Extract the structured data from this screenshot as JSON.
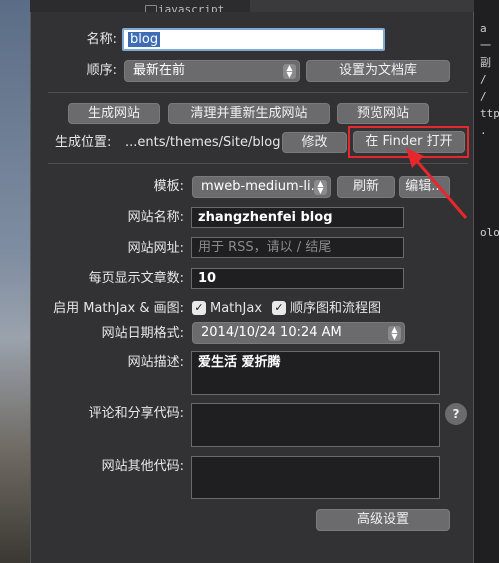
{
  "background": {
    "top_label": "iavascript",
    "right_chars": [
      "a",
      "一副",
      "/",
      "/",
      "ttp",
      ".",
      "",
      "",
      "",
      "",
      "",
      "olo"
    ]
  },
  "form": {
    "name_label": "名称:",
    "name_value": "blog",
    "order_label": "顺序:",
    "order_value": "最新在前",
    "set_doc_lib_button": "设置为文档库"
  },
  "actions": {
    "generate_button": "生成网站",
    "clean_regenerate_button": "清理并重新生成网站",
    "preview_button": "预览网站",
    "location_label": "生成位置:",
    "location_value": "...ents/themes/Site/blog",
    "modify_button": "修改",
    "open_finder_button": "在 Finder 打开"
  },
  "settings": {
    "template_label": "模板:",
    "template_value": "mweb-medium-li...",
    "refresh_button": "刷新",
    "edit_button": "编辑...",
    "site_name_label": "网站名称:",
    "site_name_value": "zhangzhenfei blog",
    "site_url_label": "网站网址:",
    "site_url_placeholder": "用于 RSS，请以 / 结尾",
    "per_page_label": "每页显示文章数:",
    "per_page_value": "10",
    "mathjax_label": "启用 MathJax & 画图:",
    "mathjax_checkbox_label": "MathJax",
    "flowchart_checkbox_label": "顺序图和流程图",
    "date_format_label": "网站日期格式:",
    "date_format_value": "2014/10/24 10:24 AM",
    "description_label": "网站描述:",
    "description_value": "爱生活 爱折腾",
    "comment_code_label": "评论和分享代码:",
    "other_code_label": "网站其他代码:",
    "help_glyph": "?",
    "advanced_button": "高级设置"
  },
  "colors": {
    "highlight": "#e8272c",
    "selection": "#3d6db5"
  },
  "icons": [
    "folder-icon",
    "stepper-icon",
    "checkmark-icon",
    "help-icon",
    "arrow-annotation"
  ]
}
